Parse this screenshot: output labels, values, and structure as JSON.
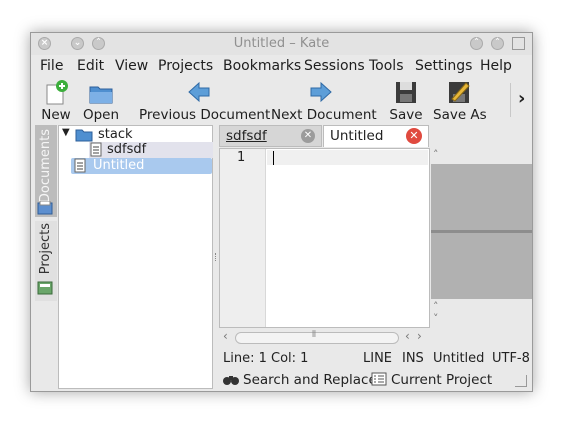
{
  "window": {
    "title": "Untitled – Kate"
  },
  "menu": [
    "File",
    "Edit",
    "View",
    "Projects",
    "Bookmarks",
    "Sessions",
    "Tools",
    "Settings",
    "Help"
  ],
  "toolbar": {
    "new": "New",
    "open": "Open",
    "prev": "Previous Document",
    "next": "Next Document",
    "save": "Save",
    "saveas": "Save As",
    "more": "›"
  },
  "sidebar": {
    "documents": "Documents",
    "projects": "Projects"
  },
  "tree": {
    "folder": "stack",
    "file1": "sdfsdf",
    "file2": "Untitled"
  },
  "tabs": {
    "tab1": "sdfsdf",
    "tab2": "Untitled"
  },
  "editor": {
    "line_number": "1"
  },
  "status": {
    "position": "Line: 1 Col: 1",
    "mode": "LINE",
    "insert": "INS",
    "doc": "Untitled",
    "encoding": "UTF-8"
  },
  "bottom": {
    "search": "Search and Replace",
    "project": "Current Project"
  },
  "colors": {
    "accent": "#6ea4de",
    "selection": "#a9c9ee",
    "close_red": "#e04a3f"
  }
}
